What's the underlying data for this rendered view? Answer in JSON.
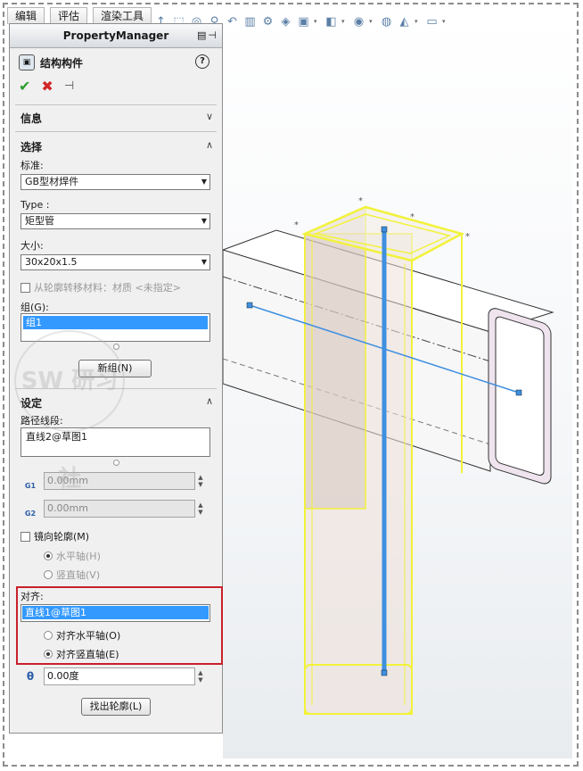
{
  "command_tabs": [
    "编辑",
    "评估",
    "渲染工具"
  ],
  "property_manager": {
    "title": "PropertyManager",
    "feature_name": "结构构件",
    "help": "?",
    "sections": {
      "info": {
        "title": "信息"
      },
      "selection": {
        "title": "选择",
        "standard_label": "标准:",
        "standard_value": "GB型材焊件",
        "type_label": "Type :",
        "type_value": "矩型管",
        "size_label": "大小:",
        "size_value": "30x20x1.5",
        "transfer_material": "从轮廓转移材料：材质 <未指定>",
        "group_label": "组(G):",
        "group_item": "组1",
        "new_group_button": "新组(N)"
      },
      "settings": {
        "title": "设定",
        "path_segments_label": "路径线段:",
        "path_segment_item": "直线2@草图1",
        "g1_label": "G1",
        "g1_value": "0.00mm",
        "g2_label": "G2",
        "g2_value": "0.00mm",
        "mirror_profile": "镜向轮廓(M)",
        "horizontal_axis": "水平轴(H)",
        "vertical_axis": "竖直轴(V)",
        "align_label": "对齐:",
        "align_item": "直线1@草图1",
        "align_horizontal": "对齐水平轴(O)",
        "align_vertical": "对齐竖直轴(E)",
        "angle_value": "0.00度",
        "angle_label": "θ",
        "locate_profile_button": "找出轮廓(L)"
      }
    }
  },
  "watermark": "SW 研习社",
  "colors": {
    "accent": "#3399ff",
    "highlight_frame": "#c8202b",
    "selection_edge": "#f2f23a",
    "path_line": "#3f8fe0"
  }
}
